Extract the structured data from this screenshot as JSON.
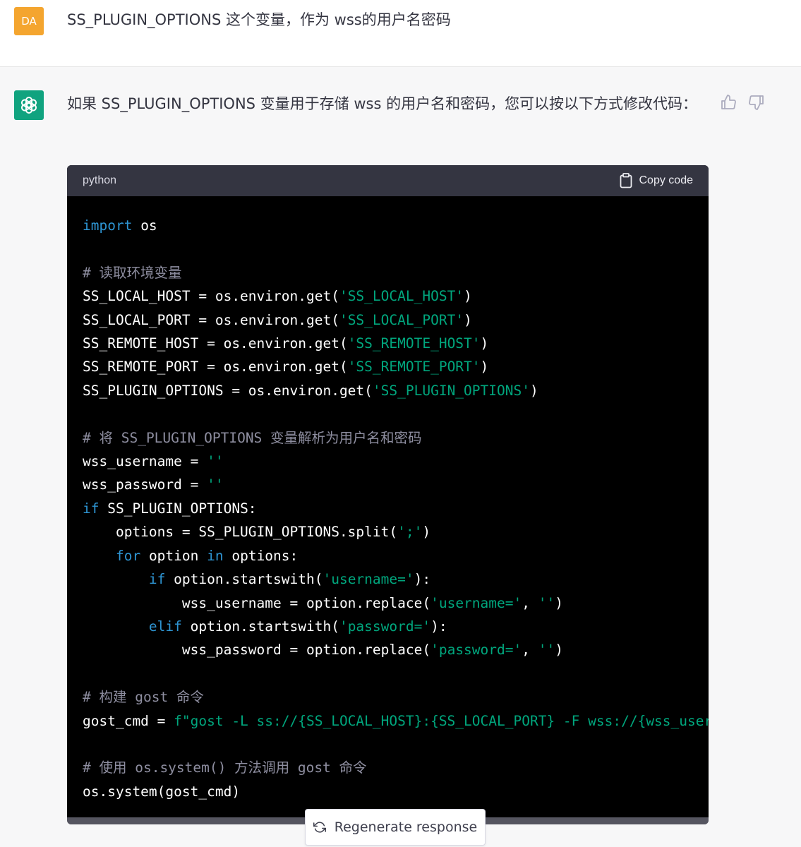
{
  "user_message": {
    "avatar_initials": "DA",
    "text": "SS_PLUGIN_OPTIONS 这个变量，作为 wss的用户名密码"
  },
  "assistant_message": {
    "text": "如果 SS_PLUGIN_OPTIONS 变量用于存储 wss 的用户名和密码，您可以按以下方式修改代码："
  },
  "code_block": {
    "language": "python",
    "copy_label": "Copy code",
    "lines": [
      [
        {
          "t": "kw",
          "v": "import"
        },
        {
          "t": "n",
          "v": " os"
        }
      ],
      [],
      [
        {
          "t": "cm",
          "v": "# 读取环境变量"
        }
      ],
      [
        {
          "t": "n",
          "v": "SS_LOCAL_HOST = os.environ.get("
        },
        {
          "t": "str",
          "v": "'SS_LOCAL_HOST'"
        },
        {
          "t": "n",
          "v": ")"
        }
      ],
      [
        {
          "t": "n",
          "v": "SS_LOCAL_PORT = os.environ.get("
        },
        {
          "t": "str",
          "v": "'SS_LOCAL_PORT'"
        },
        {
          "t": "n",
          "v": ")"
        }
      ],
      [
        {
          "t": "n",
          "v": "SS_REMOTE_HOST = os.environ.get("
        },
        {
          "t": "str",
          "v": "'SS_REMOTE_HOST'"
        },
        {
          "t": "n",
          "v": ")"
        }
      ],
      [
        {
          "t": "n",
          "v": "SS_REMOTE_PORT = os.environ.get("
        },
        {
          "t": "str",
          "v": "'SS_REMOTE_PORT'"
        },
        {
          "t": "n",
          "v": ")"
        }
      ],
      [
        {
          "t": "n",
          "v": "SS_PLUGIN_OPTIONS = os.environ.get("
        },
        {
          "t": "str",
          "v": "'SS_PLUGIN_OPTIONS'"
        },
        {
          "t": "n",
          "v": ")"
        }
      ],
      [],
      [
        {
          "t": "cm",
          "v": "# 将 SS_PLUGIN_OPTIONS 变量解析为用户名和密码"
        }
      ],
      [
        {
          "t": "n",
          "v": "wss_username = "
        },
        {
          "t": "str",
          "v": "''"
        }
      ],
      [
        {
          "t": "n",
          "v": "wss_password = "
        },
        {
          "t": "str",
          "v": "''"
        }
      ],
      [
        {
          "t": "kw",
          "v": "if"
        },
        {
          "t": "n",
          "v": " SS_PLUGIN_OPTIONS:"
        }
      ],
      [
        {
          "t": "n",
          "v": "    options = SS_PLUGIN_OPTIONS.split("
        },
        {
          "t": "str",
          "v": "';'"
        },
        {
          "t": "n",
          "v": ")"
        }
      ],
      [
        {
          "t": "n",
          "v": "    "
        },
        {
          "t": "kw",
          "v": "for"
        },
        {
          "t": "n",
          "v": " option "
        },
        {
          "t": "kw",
          "v": "in"
        },
        {
          "t": "n",
          "v": " options:"
        }
      ],
      [
        {
          "t": "n",
          "v": "        "
        },
        {
          "t": "kw",
          "v": "if"
        },
        {
          "t": "n",
          "v": " option.startswith("
        },
        {
          "t": "str",
          "v": "'username='"
        },
        {
          "t": "n",
          "v": "):"
        }
      ],
      [
        {
          "t": "n",
          "v": "            wss_username = option.replace("
        },
        {
          "t": "str",
          "v": "'username='"
        },
        {
          "t": "n",
          "v": ", "
        },
        {
          "t": "str",
          "v": "''"
        },
        {
          "t": "n",
          "v": ")"
        }
      ],
      [
        {
          "t": "n",
          "v": "        "
        },
        {
          "t": "kw",
          "v": "elif"
        },
        {
          "t": "n",
          "v": " option.startswith("
        },
        {
          "t": "str",
          "v": "'password='"
        },
        {
          "t": "n",
          "v": "):"
        }
      ],
      [
        {
          "t": "n",
          "v": "            wss_password = option.replace("
        },
        {
          "t": "str",
          "v": "'password='"
        },
        {
          "t": "n",
          "v": ", "
        },
        {
          "t": "str",
          "v": "''"
        },
        {
          "t": "n",
          "v": ")"
        }
      ],
      [],
      [
        {
          "t": "cm",
          "v": "# 构建 gost 命令"
        }
      ],
      [
        {
          "t": "n",
          "v": "gost_cmd = "
        },
        {
          "t": "str",
          "v": "f\"gost -L ss://{SS_LOCAL_HOST}:{SS_LOCAL_PORT} -F wss://{wss_user"
        }
      ],
      [],
      [
        {
          "t": "cm",
          "v": "# 使用 os.system() 方法调用 gost 命令"
        }
      ],
      [
        {
          "t": "n",
          "v": "os.system(gost_cmd)"
        }
      ]
    ]
  },
  "regenerate_label": "Regenerate response",
  "colors": {
    "user_avatar": "#f4a52f",
    "bot_avatar": "#10a37f",
    "keyword": "#2e95d3",
    "string": "#00a67d",
    "comment": "#8e8ea0"
  },
  "icons": {
    "bot_avatar": "openai-logo-icon",
    "thumb_up": "thumb-up-icon",
    "thumb_down": "thumb-down-icon",
    "copy": "clipboard-icon",
    "regenerate": "refresh-icon"
  }
}
